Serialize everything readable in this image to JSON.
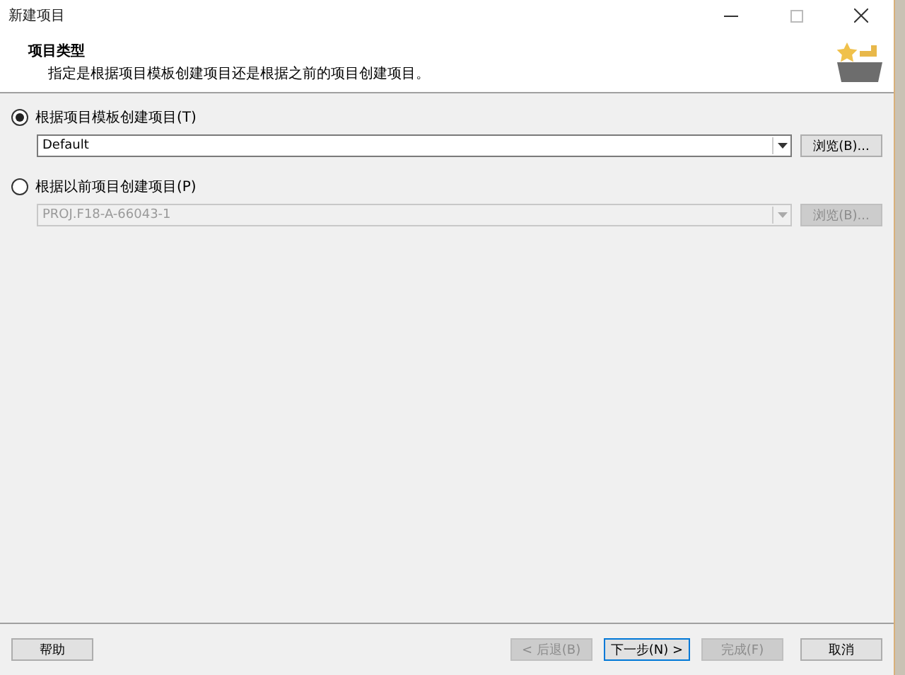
{
  "window": {
    "title": "新建项目"
  },
  "header": {
    "title": "项目类型",
    "description": "指定是根据项目模板创建项目还是根据之前的项目创建项目。"
  },
  "options": [
    {
      "label": "根据项目模板创建项目(T)",
      "selected": true,
      "combo_value": "Default",
      "combo_disabled": false,
      "browse": {
        "label": "浏览(B)...",
        "disabled": false
      }
    },
    {
      "label": "根据以前项目创建项目(P)",
      "selected": false,
      "combo_value": "PROJ.F18-A-66043-1",
      "combo_disabled": true,
      "browse": {
        "label": "浏览(B)...",
        "disabled": true
      }
    }
  ],
  "help_button": {
    "label": "帮助",
    "disabled": false
  },
  "buttons": [
    {
      "label": "< 后退(B)",
      "disabled": true,
      "default": false
    },
    {
      "label": "下一步(N) >",
      "disabled": false,
      "default": true
    },
    {
      "label": "完成(F)",
      "disabled": true,
      "default": false
    },
    {
      "label": "取消",
      "disabled": false,
      "default": false
    }
  ]
}
